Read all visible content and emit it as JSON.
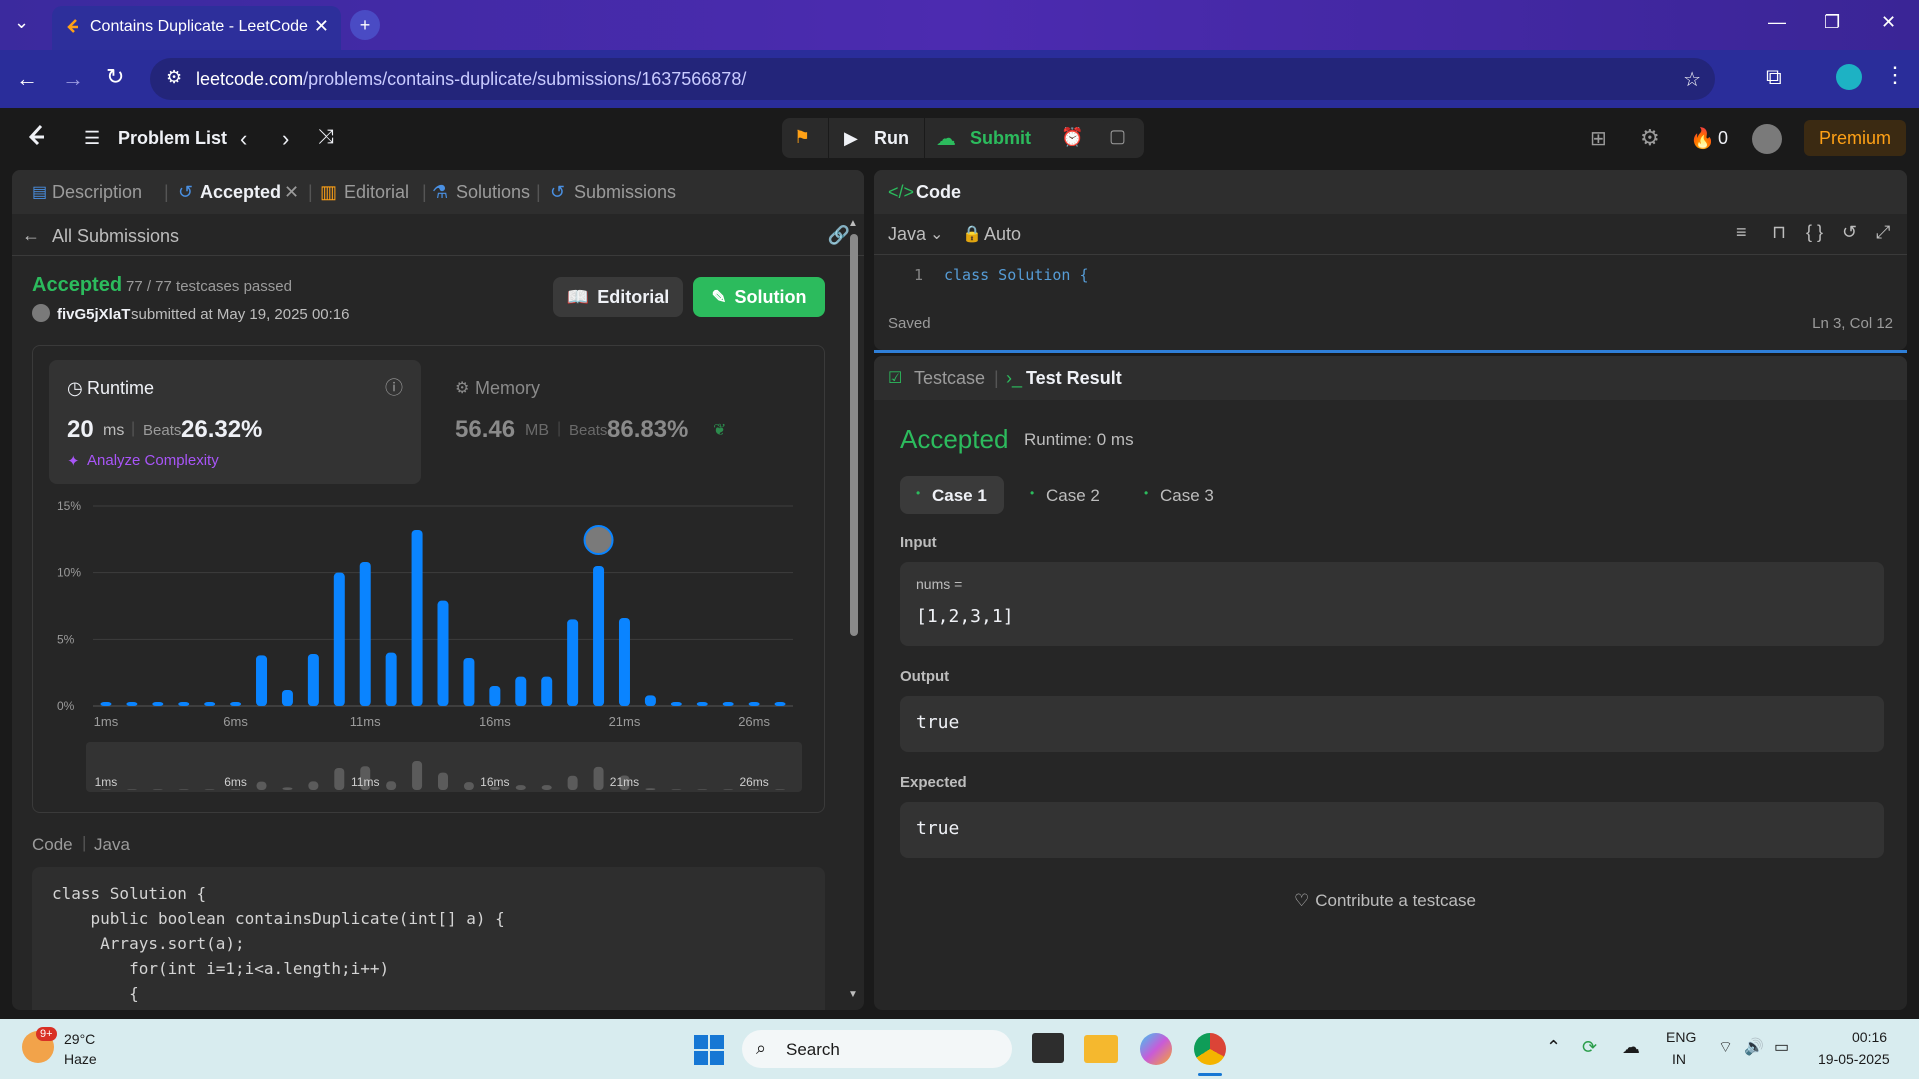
{
  "browser": {
    "tab_title": "Contains Duplicate - LeetCode",
    "url_domain": "leetcode.com",
    "url_path": "/problems/contains-duplicate/submissions/1637566878/"
  },
  "header": {
    "problem_list": "Problem List",
    "run": "Run",
    "submit": "Submit",
    "streak": "0",
    "premium": "Premium"
  },
  "left_tabs": [
    "Description",
    "Accepted",
    "Editorial",
    "Solutions",
    "Submissions"
  ],
  "submission": {
    "back_label": "All Submissions",
    "status": "Accepted",
    "testcases": "77 / 77 testcases passed",
    "user": "fivG5jXlaT",
    "submitted_at": "submitted at May 19, 2025 00:16",
    "editorial_btn": "Editorial",
    "solution_btn": "Solution",
    "runtime_label": "Runtime",
    "runtime_value": "20",
    "runtime_unit": "ms",
    "beats_label": "Beats",
    "runtime_beats": "26.32%",
    "analyze": "Analyze Complexity",
    "memory_label": "Memory",
    "memory_value": "56.46",
    "memory_unit": "MB",
    "memory_beats": "86.83%",
    "code_label": "Code",
    "code_lang": "Java"
  },
  "chart_data": {
    "type": "bar",
    "y_ticks": [
      "15%",
      "10%",
      "5%",
      "0%"
    ],
    "x_ticks": [
      "1ms",
      "6ms",
      "11ms",
      "16ms",
      "21ms",
      "26ms"
    ],
    "ylim": [
      0,
      15
    ],
    "categories": [
      "1ms",
      "2ms",
      "3ms",
      "4ms",
      "5ms",
      "6ms",
      "7ms",
      "8ms",
      "9ms",
      "10ms",
      "11ms",
      "12ms",
      "13ms",
      "14ms",
      "15ms",
      "16ms",
      "17ms",
      "18ms",
      "19ms",
      "20ms",
      "21ms",
      "22ms",
      "23ms",
      "24ms",
      "25ms",
      "26ms",
      "27ms"
    ],
    "values": [
      0.3,
      0.3,
      0.3,
      0.3,
      0.3,
      0.3,
      3.8,
      1.2,
      3.9,
      10.0,
      10.8,
      4.0,
      13.2,
      7.9,
      3.6,
      1.5,
      2.2,
      2.2,
      6.5,
      10.5,
      6.6,
      0.8,
      0.3,
      0.3,
      0.3,
      0.3,
      0.3
    ],
    "highlight_index": 19
  },
  "code_lines": [
    "class Solution {",
    "    public boolean containsDuplicate(int[] a) {",
    "     Arrays.sort(a);",
    "        for(int i=1;i<a.length;i++)",
    "        {"
  ],
  "editor": {
    "title": "Code",
    "lang": "Java",
    "mode": "Auto",
    "line_no": "1",
    "line": "class Solution {",
    "saved": "Saved",
    "cursor": "Ln 3, Col 12"
  },
  "result": {
    "tab_testcase": "Testcase",
    "tab_result": "Test Result",
    "status": "Accepted",
    "runtime": "Runtime: 0 ms",
    "cases": [
      "Case 1",
      "Case 2",
      "Case 3"
    ],
    "input_label": "Input",
    "input_var": "nums =",
    "input_value": "[1,2,3,1]",
    "output_label": "Output",
    "output_value": "true",
    "expected_label": "Expected",
    "expected_value": "true",
    "contribute": "Contribute a testcase"
  },
  "taskbar": {
    "weather_temp": "29°C",
    "weather_desc": "Haze",
    "weather_badge": "9+",
    "search": "Search",
    "lang1": "ENG",
    "lang2": "IN",
    "time": "00:16",
    "date": "19-05-2025"
  }
}
